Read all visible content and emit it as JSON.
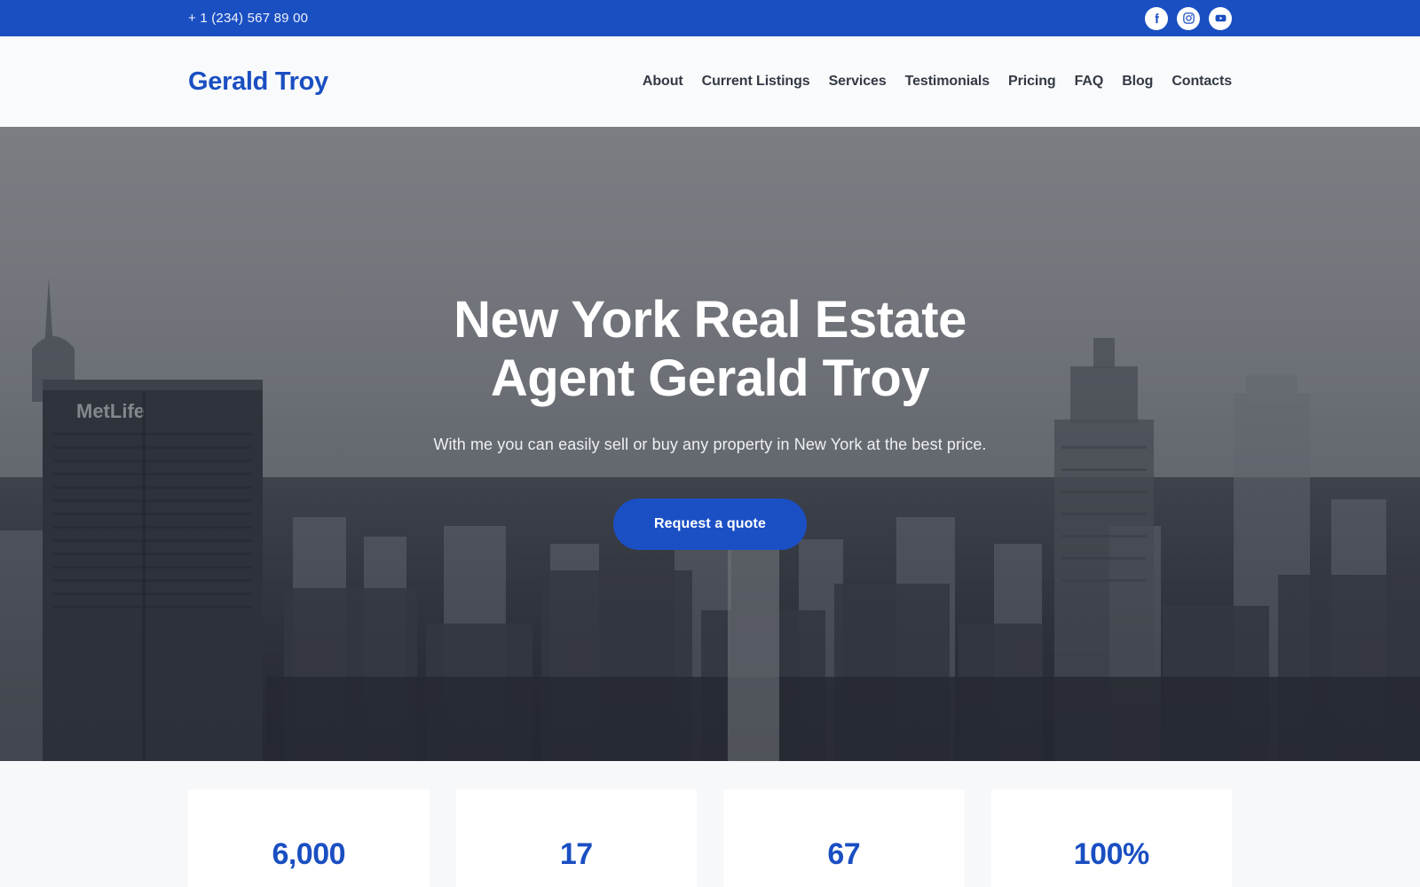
{
  "topbar": {
    "phone": "+ 1 (234) 567 89 00",
    "socials": [
      {
        "name": "facebook-icon",
        "label": "Facebook"
      },
      {
        "name": "instagram-icon",
        "label": "Instagram"
      },
      {
        "name": "youtube-icon",
        "label": "YouTube"
      }
    ],
    "background_color": "#1a4fc2"
  },
  "header": {
    "logo": "Gerald Troy",
    "nav": [
      {
        "label": "About"
      },
      {
        "label": "Current Listings"
      },
      {
        "label": "Services"
      },
      {
        "label": "Testimonials"
      },
      {
        "label": "Pricing"
      },
      {
        "label": "FAQ"
      },
      {
        "label": "Blog"
      },
      {
        "label": "Contacts"
      }
    ]
  },
  "hero": {
    "title_line1": "New York Real Estate",
    "title_line2": "Agent Gerald Troy",
    "subtitle": "With me you can easily sell or buy any property in New York at the best price.",
    "cta_label": "Request a quote",
    "background_description": "New York City skyline aerial photo with MetLife building",
    "overlay_color": "#1c1f26"
  },
  "stats": {
    "items": [
      {
        "value": "6,000"
      },
      {
        "value": "17"
      },
      {
        "value": "67"
      },
      {
        "value": "100%"
      }
    ],
    "accent_color": "#1a4fc2"
  }
}
